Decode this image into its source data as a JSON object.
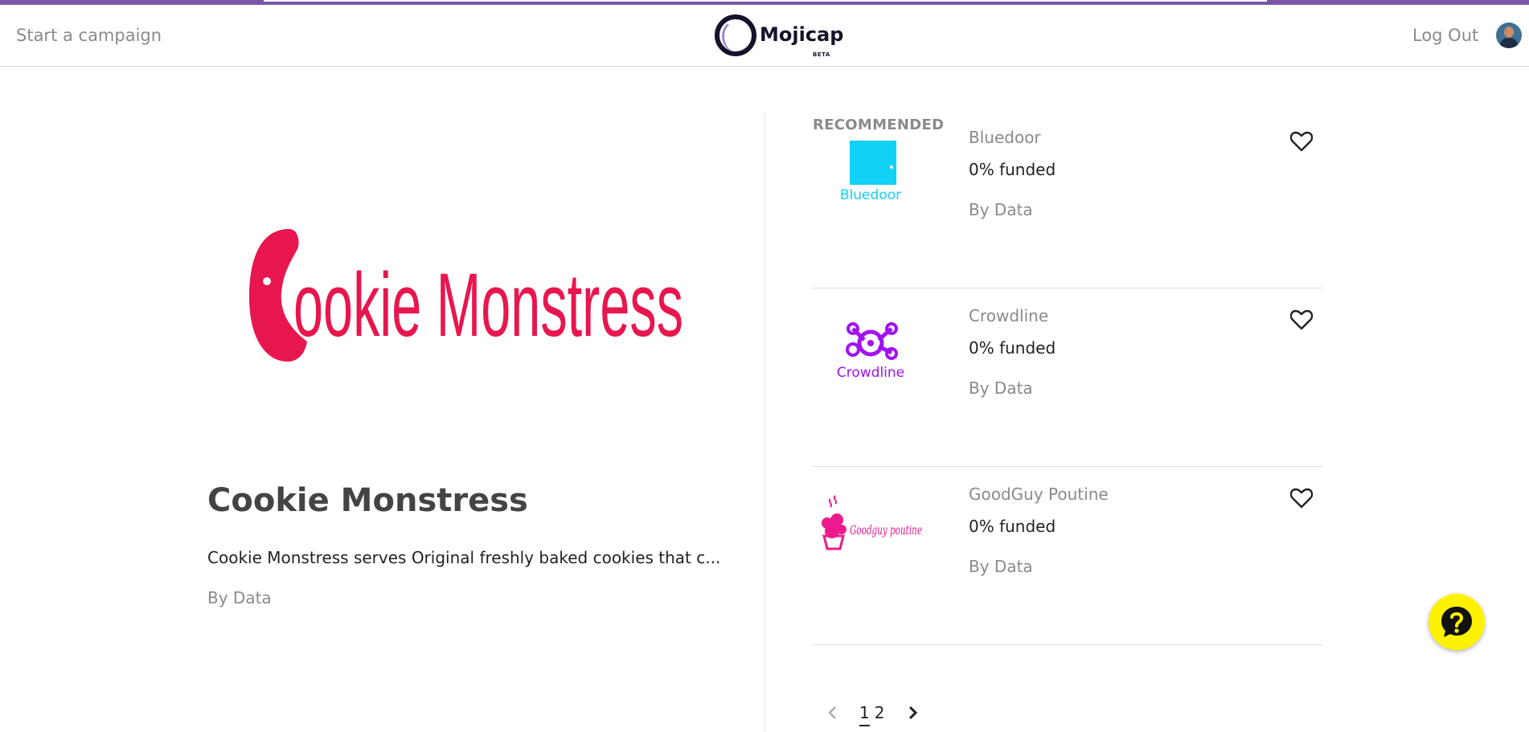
{
  "header": {
    "start_campaign": "Start a campaign",
    "brand": "Mojicap",
    "brand_badge": "BETA",
    "logout": "Log Out",
    "avatar_icon": "user-avatar"
  },
  "featured": {
    "logo_text": "ookie Monstress",
    "title": "Cookie Monstress",
    "description": "Cookie Monstress serves Original freshly baked cookies that c...",
    "by": "By Data"
  },
  "recommended": {
    "heading": "RECOMMENDED",
    "items": [
      {
        "name": "Bluedoor",
        "logo_text": "Bluedoor",
        "funded": "0% funded",
        "by": "By Data",
        "icon": "heart-outline-icon"
      },
      {
        "name": "Crowdline",
        "logo_text": "Crowdline",
        "funded": "0% funded",
        "by": "By Data",
        "icon": "heart-outline-icon"
      },
      {
        "name": "GoodGuy Poutine",
        "logo_text": "Goodguy poutine",
        "funded": "0% funded",
        "by": "By Data",
        "icon": "heart-outline-icon"
      }
    ]
  },
  "pagination": {
    "pages": [
      "1",
      "2"
    ],
    "current": "1"
  },
  "colors": {
    "accent_bar": "#7a55a8",
    "cookie_red": "#e8164e",
    "bluedoor": "#11d1f5",
    "crowdline": "#a112f0",
    "goodguy": "#ec1a8c",
    "help_yellow": "#fff200"
  }
}
